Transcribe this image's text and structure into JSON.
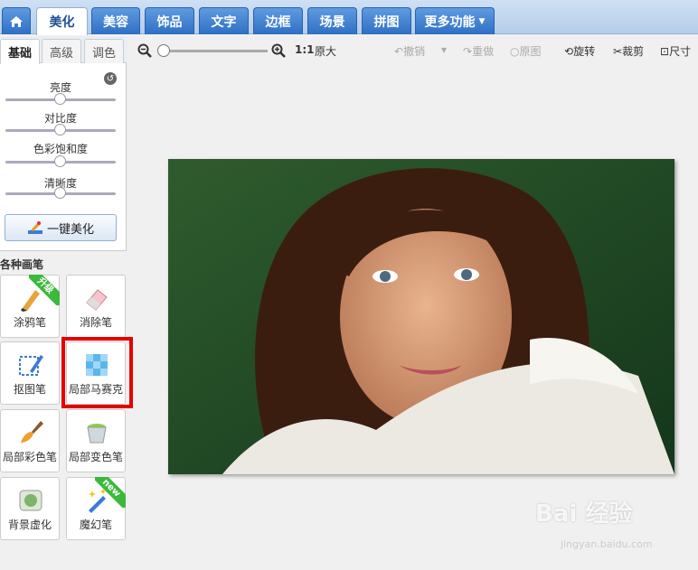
{
  "nav": {
    "tabs": [
      {
        "label": "美化",
        "active": true
      },
      {
        "label": "美容"
      },
      {
        "label": "饰品"
      },
      {
        "label": "文字"
      },
      {
        "label": "边框"
      },
      {
        "label": "场景"
      },
      {
        "label": "拼图"
      },
      {
        "label": "更多功能"
      }
    ]
  },
  "sidebar": {
    "subtabs": [
      {
        "label": "基础",
        "active": true
      },
      {
        "label": "高级"
      },
      {
        "label": "调色"
      }
    ],
    "sliders": [
      {
        "label": "亮度",
        "value": 0.5
      },
      {
        "label": "对比度",
        "value": 0.5
      },
      {
        "label": "色彩饱和度",
        "value": 0.5
      },
      {
        "label": "清晰度",
        "value": 0.5
      }
    ],
    "onekey_label": "一键美化",
    "brush_title": "各种画笔",
    "brushes": [
      {
        "label": "涂鸦笔",
        "badge": "升级",
        "icon": "brush-pen-icon"
      },
      {
        "label": "消除笔",
        "icon": "eraser-icon"
      },
      {
        "label": "抠图笔",
        "icon": "cutout-pen-icon"
      },
      {
        "label": "局部马赛克",
        "icon": "mosaic-icon",
        "highlighted": true
      },
      {
        "label": "局部彩色笔",
        "icon": "paintbrush-icon"
      },
      {
        "label": "局部变色笔",
        "icon": "color-bucket-icon"
      },
      {
        "label": "背景虚化",
        "icon": "blur-icon"
      },
      {
        "label": "魔幻笔",
        "badge": "new",
        "icon": "magic-wand-icon"
      }
    ]
  },
  "toolbar": {
    "ratio": "1:1",
    "original_size": "原大",
    "undo": "撤销",
    "redo": "重做",
    "original": "原图",
    "rotate": "旋转",
    "crop": "裁剪",
    "size": "尺寸"
  },
  "photo": {
    "watermark_text": "Bai 经验",
    "watermark_url": "jingyan.baidu.com"
  }
}
